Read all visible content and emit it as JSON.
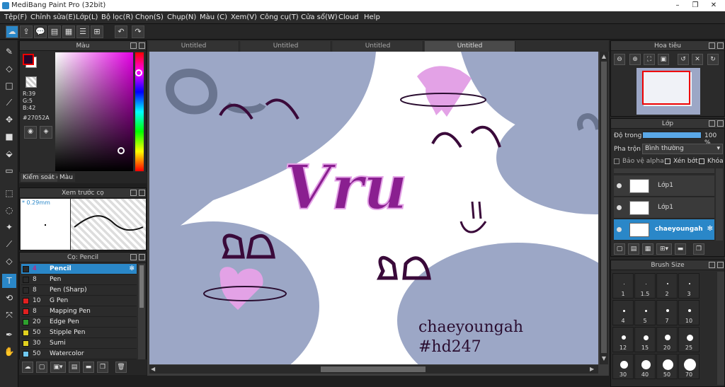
{
  "window": {
    "title": "MediBang Paint Pro (32bit)"
  },
  "menu": [
    "Tệp(F)",
    "Chỉnh sửa(E)",
    "Lớp(L)",
    "Bộ lọc(R)",
    "Chọn(S)",
    "Chụp(N)",
    "Màu (C)",
    "Xem(V)",
    "Công cụ(T)",
    "Cửa sổ(W)",
    "Cloud",
    "Help"
  ],
  "color": {
    "title": "Màu",
    "r": "R:39",
    "g": "G:5",
    "b": "B:42",
    "hex": "#27052A",
    "fg": "#27052A"
  },
  "colortabs": {
    "t1": "Kiểm soát cọ",
    "t2": "Màu"
  },
  "preview": {
    "title": "Xem trước cọ",
    "size": "0.29mm"
  },
  "brush": {
    "title": "Cọ: Pencil",
    "items": [
      {
        "size": "4",
        "name": "Pencil",
        "color": "#2a2a2a"
      },
      {
        "size": "8",
        "name": "Pen",
        "color": "#2a2a2a"
      },
      {
        "size": "8",
        "name": "Pen (Sharp)",
        "color": "#2a2a2a"
      },
      {
        "size": "10",
        "name": "G Pen",
        "color": "#e02020"
      },
      {
        "size": "8",
        "name": "Mapping Pen",
        "color": "#e02020"
      },
      {
        "size": "20",
        "name": "Edge Pen",
        "color": "#2ea02e"
      },
      {
        "size": "50",
        "name": "Stipple Pen",
        "color": "#e0d020"
      },
      {
        "size": "30",
        "name": "Sumi",
        "color": "#e0d020"
      },
      {
        "size": "50",
        "name": "Watercolor",
        "color": "#70c8f0"
      }
    ]
  },
  "tabs": [
    "Untitled",
    "Untitled",
    "Untitled",
    "Untitled"
  ],
  "art": {
    "t1": "Vru",
    "c1": "chaeyoungah",
    "c2": "#hd247"
  },
  "nav": {
    "title": "Hoa tiêu"
  },
  "layer": {
    "title": "Lớp",
    "opacity_label": "Độ trong",
    "opacity": "100 %",
    "blend_label": "Pha trộn",
    "blend": "Bình thường",
    "alpha": "Bảo vệ alpha",
    "clip": "Xén bớt",
    "lock": "Khóa",
    "rows": [
      {
        "name": "Lớp1"
      },
      {
        "name": "Lớp1"
      },
      {
        "name": "chaeyoungah"
      }
    ]
  },
  "brushsize": {
    "title": "Brush Size",
    "cells": [
      "1",
      "1.5",
      "2",
      "3",
      "4",
      "5",
      "7",
      "10",
      "12",
      "15",
      "20",
      "25",
      "30",
      "40",
      "50",
      "70"
    ]
  }
}
